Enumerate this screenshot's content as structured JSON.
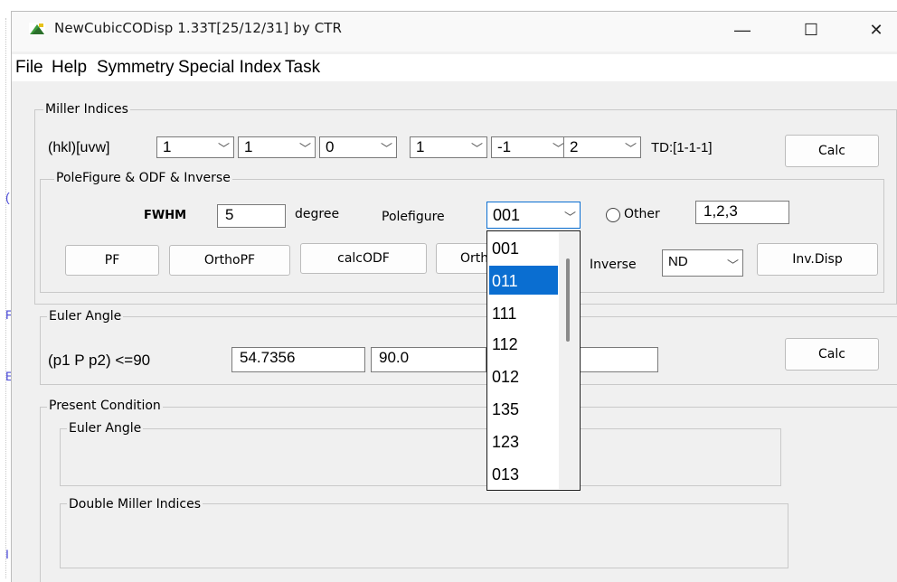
{
  "window": {
    "title": "NewCubicCODisp 1.33T[25/12/31] by CTR",
    "minimize": "—",
    "maximize": "☐",
    "close": "✕"
  },
  "menu": [
    "File",
    "Help",
    "Symmetry",
    "Special Index",
    "Task"
  ],
  "miller": {
    "group_label": "Miller Indices",
    "hkl_label": "(hkl)[uvw]",
    "h": "1",
    "k": "1",
    "l": "0",
    "u": "1",
    "v": "-1",
    "w": "2",
    "td": "TD:[1-1-1]",
    "calc": "Calc"
  },
  "pole": {
    "group_label": "PoleFigure & ODF & Inverse",
    "fwhm_label": "FWHM",
    "fwhm_value": "5",
    "degree_label": "degree",
    "polefigure_label": "Polefigure",
    "polefigure_value": "001",
    "other_label": "Other",
    "other_value": "1,2,3",
    "pf": "PF",
    "orthopf": "OrthoPF",
    "calcodf": "calcODF",
    "ortho_partial": "Orth",
    "inverse_label": "Inverse",
    "inverse_value": "ND",
    "invdisp": "Inv.Disp"
  },
  "dropdown_items": [
    "001",
    "011",
    "111",
    "112",
    "012",
    "135",
    "123",
    "013"
  ],
  "dropdown_selected": "011",
  "euler": {
    "group_label": "Euler Angle",
    "label": "(p1 P p2) <=90",
    "p1": "54.7356",
    "P": "90.0",
    "p2": "",
    "calc": "Calc"
  },
  "present": {
    "group_label": "Present Condition",
    "euler_label": "Euler Angle",
    "double_label": "Double Miller Indices"
  },
  "colors": {
    "selection": "#0a6ed1",
    "window_bg": "#f0f0f0"
  }
}
